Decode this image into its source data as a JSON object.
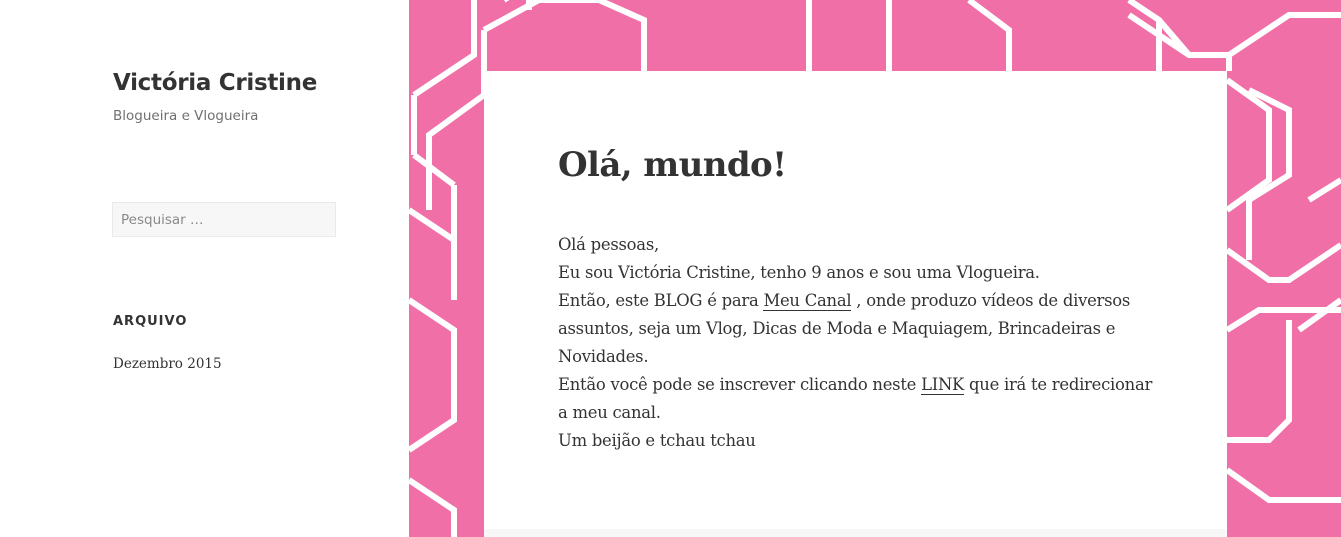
{
  "site": {
    "title": "Victória Cristine",
    "tagline": "Blogueira e Vlogueira"
  },
  "search": {
    "placeholder": "Pesquisar …"
  },
  "archive": {
    "heading": "Arquivo",
    "items": [
      "Dezembro 2015"
    ]
  },
  "post": {
    "title": "Olá, mundo!",
    "line1": "Olá pessoas,",
    "line2": "Eu sou Victória Cristine, tenho 9 anos e sou uma Vlogueira.",
    "line3_before": "Então, este BLOG é para ",
    "line3_link": "Meu Canal",
    "line3_after": " , onde produzo vídeos de diversos assuntos, seja um Vlog, Dicas de Moda e Maquiagem, Brincadeiras e Novidades.",
    "line4_before": "Então você pode se inscrever clicando neste ",
    "line4_link": "LINK",
    "line4_after": " que irá te redirecionar a meu canal.",
    "line5": "Um beijão e tchau tchau"
  },
  "colors": {
    "background_pattern": "#f06fa7",
    "pattern_lines": "#ffffff",
    "text": "#333333",
    "muted": "#707070"
  }
}
